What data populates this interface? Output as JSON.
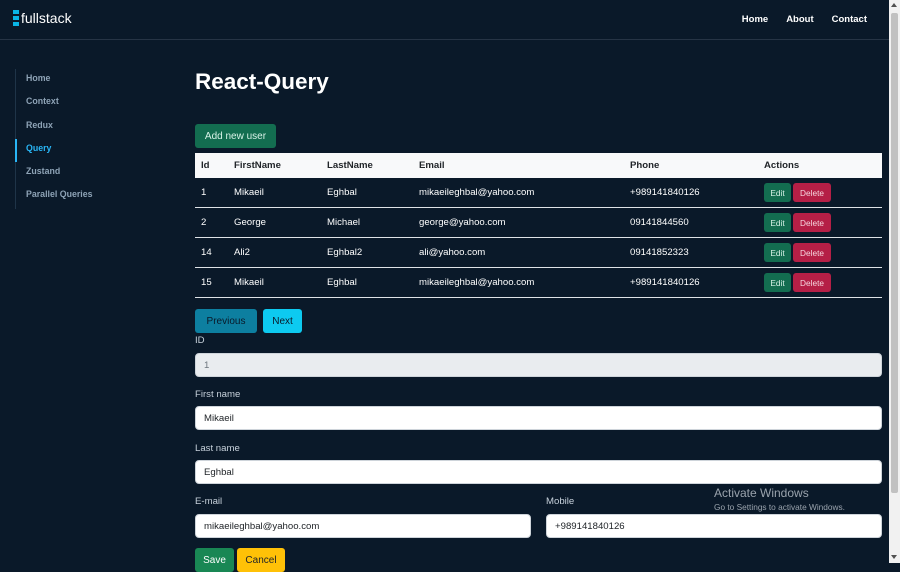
{
  "brand": {
    "name": "fullstack",
    "icon": "stacked-bars-logo"
  },
  "nav": {
    "links": [
      "Home",
      "About",
      "Contact"
    ]
  },
  "sidebar": {
    "items": [
      "Home",
      "Context",
      "Redux",
      "Query",
      "Zustand",
      "Parallel Queries"
    ],
    "active": "Query"
  },
  "page": {
    "title": "React-Query",
    "add_button": "Add new user"
  },
  "table": {
    "headers": [
      "Id",
      "FirstName",
      "LastName",
      "Email",
      "Phone",
      "Actions"
    ],
    "rows": [
      {
        "id": "1",
        "first": "Mikaeil",
        "last": "Eghbal",
        "email": "mikaeileghbal@yahoo.com",
        "phone": "+989141840126"
      },
      {
        "id": "2",
        "first": "George",
        "last": "Michael",
        "email": "george@yahoo.com",
        "phone": "09141844560"
      },
      {
        "id": "14",
        "first": "Ali2",
        "last": "Eghbal2",
        "email": "ali@yahoo.com",
        "phone": "09141852323"
      },
      {
        "id": "15",
        "first": "Mikaeil",
        "last": "Eghbal",
        "email": "mikaeileghbal@yahoo.com",
        "phone": "+989141840126"
      }
    ],
    "edit_label": "Edit",
    "delete_label": "Delete"
  },
  "pager": {
    "previous": "Previous",
    "next": "Next"
  },
  "form": {
    "id": {
      "label": "ID",
      "value": "1"
    },
    "first_name": {
      "label": "First name",
      "value": "Mikaeil"
    },
    "last_name": {
      "label": "Last name",
      "value": "Eghbal"
    },
    "email": {
      "label": "E-mail",
      "value": "mikaeileghbal@yahoo.com"
    },
    "mobile": {
      "label": "Mobile",
      "value": "+989141840126"
    },
    "save": "Save",
    "cancel": "Cancel"
  },
  "watermark": {
    "title": "Activate Windows",
    "subtitle": "Go to Settings to activate Windows."
  },
  "colors": {
    "background": "#0a1929",
    "accent": "#0dcaf0",
    "success": "#198754",
    "danger": "#b51f46",
    "warning": "#ffc107"
  }
}
